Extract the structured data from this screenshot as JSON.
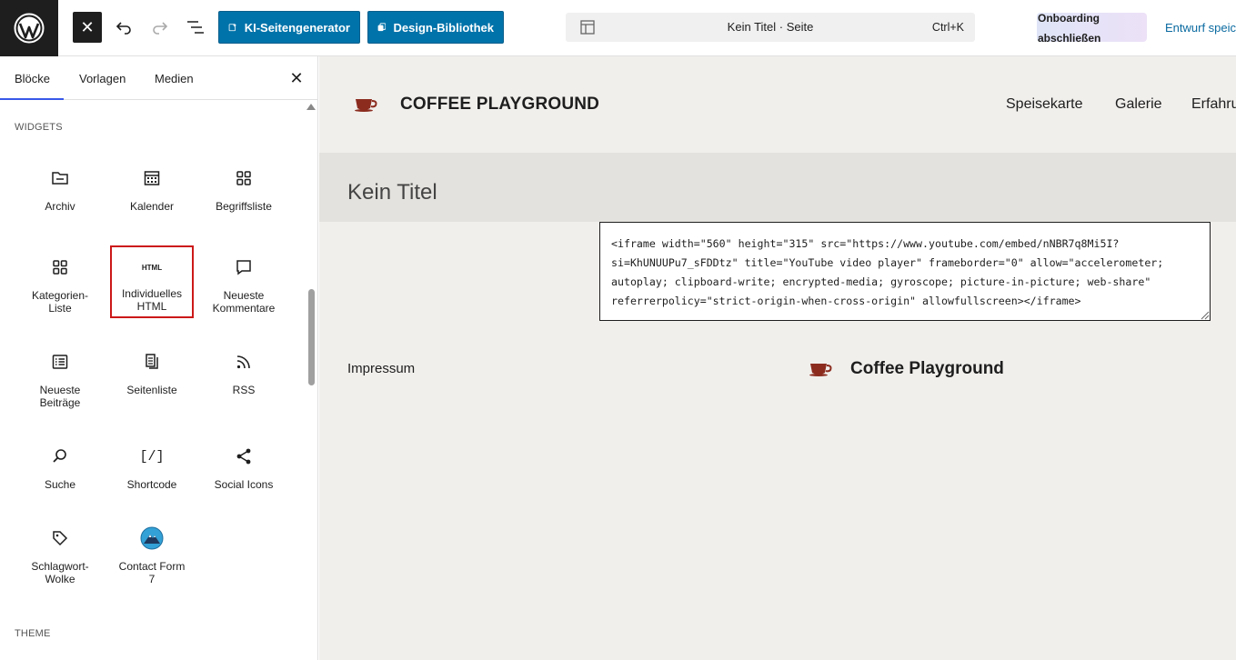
{
  "topbar": {
    "wp_logo": "wordpress-logo",
    "ai_button": "KI-Seitengenerator",
    "design_button": "Design-Bibliothek",
    "command": {
      "title": "Kein Titel · Seite",
      "shortcut": "Ctrl+K"
    },
    "onboarding_line1": "Onboarding",
    "onboarding_line2": "abschließen",
    "draft": "Entwurf speic"
  },
  "sidebar": {
    "tabs": [
      "Blöcke",
      "Vorlagen",
      "Medien"
    ],
    "active_tab": "Blöcke",
    "section_widgets": "WIDGETS",
    "section_theme": "THEME",
    "blocks": [
      {
        "label": "Archiv",
        "icon": "archive-icon"
      },
      {
        "label": "Kalender",
        "icon": "calendar-icon"
      },
      {
        "label": "Begriffsliste",
        "icon": "grid-icon"
      },
      {
        "label": "Kategorien-\nListe",
        "icon": "categories-icon"
      },
      {
        "label": "Individuelles\nHTML",
        "icon": "html-icon",
        "icon_text": "HTML"
      },
      {
        "label": "Neueste\nKommentare",
        "icon": "comment-icon"
      },
      {
        "label": "Neueste\nBeiträge",
        "icon": "post-list-icon"
      },
      {
        "label": "Seitenliste",
        "icon": "page-list-icon"
      },
      {
        "label": "RSS",
        "icon": "rss-icon"
      },
      {
        "label": "Suche",
        "icon": "search-icon"
      },
      {
        "label": "Shortcode",
        "icon": "shortcode-icon",
        "icon_text": "[/]"
      },
      {
        "label": "Social Icons",
        "icon": "share-icon"
      },
      {
        "label": "Schlagwort-\nWolke",
        "icon": "tag-icon"
      },
      {
        "label": "Contact Form\n7",
        "icon": "contact-form-icon"
      }
    ]
  },
  "canvas": {
    "brand": "COFFEE PLAYGROUND",
    "nav": [
      "Speisekarte",
      "Galerie",
      "Erfahru"
    ],
    "page_title": "Kein Titel",
    "html_code": "<iframe width=\"560\" height=\"315\" src=\"https://www.youtube.com/embed/nNBR7q8Mi5I?\nsi=KhUNUUPu7_sFDDtz\" title=\"YouTube video player\" frameborder=\"0\" allow=\"accelerometer;\nautoplay; clipboard-write; encrypted-media; gyroscope; picture-in-picture; web-share\"\nreferrerpolicy=\"strict-origin-when-cross-origin\" allowfullscreen></iframe>",
    "footer_left": "Impressum",
    "footer_brand": "Coffee Playground"
  },
  "colors": {
    "accent": "#0073aa",
    "selection": "#cc1818",
    "tab_indicator": "#3858e9",
    "cup": "#8b2c1f"
  }
}
